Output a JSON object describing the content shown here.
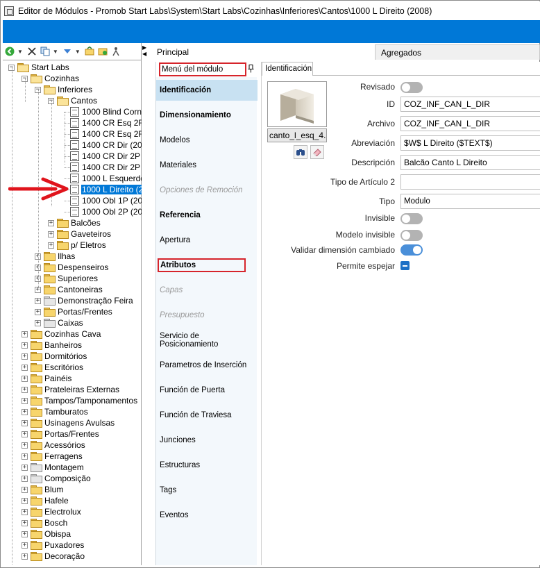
{
  "window": {
    "title": "Editor de Módulos - Promob Start Labs\\System\\Start Labs\\Cozinhas\\Inferiores\\Cantos\\1000 L Direito (2008)"
  },
  "toolbar": {
    "icons": [
      "back-icon",
      "delete-icon",
      "copy-icon",
      "move-down-icon",
      "refresh-icon",
      "folder-add-icon",
      "person-icon"
    ]
  },
  "tree": {
    "nodes": [
      {
        "label": "Start Labs",
        "expander": "−",
        "type": "folder-open"
      },
      {
        "label": "Cozinhas",
        "expander": "−",
        "type": "folder-open"
      },
      {
        "label": "Inferiores",
        "expander": "−",
        "type": "folder-open"
      },
      {
        "label": "Cantos",
        "expander": "−",
        "type": "folder-open"
      },
      {
        "label": "1000 Blind Corn",
        "type": "doc"
      },
      {
        "label": "1400 CR Esq 2F",
        "type": "doc"
      },
      {
        "label": "1400 CR Esq 2F",
        "type": "doc"
      },
      {
        "label": "1400 CR Dir (20",
        "type": "doc"
      },
      {
        "label": "1400 CR Dir 2P",
        "type": "doc"
      },
      {
        "label": "1400 CR Dir 2P",
        "type": "doc"
      },
      {
        "label": "1000 L Esquerdo",
        "type": "doc"
      },
      {
        "label": "1000 L Direito (2",
        "type": "doc",
        "selected": true
      },
      {
        "label": "1000 Obl 1P (20",
        "type": "doc"
      },
      {
        "label": "1000 Obl 2P (20",
        "type": "doc"
      },
      {
        "label": "Balcões",
        "expander": "+",
        "type": "folder"
      },
      {
        "label": "Gaveteiros",
        "expander": "+",
        "type": "folder"
      },
      {
        "label": "p/ Eletros",
        "expander": "+",
        "type": "folder"
      },
      {
        "label": "Ilhas",
        "expander": "+",
        "type": "folder"
      },
      {
        "label": "Despenseiros",
        "expander": "+",
        "type": "folder"
      },
      {
        "label": "Superiores",
        "expander": "+",
        "type": "folder"
      },
      {
        "label": "Cantoneiras",
        "expander": "+",
        "type": "folder"
      },
      {
        "label": "Demonstração Feira",
        "expander": "+",
        "type": "folder-gray"
      },
      {
        "label": "Portas/Frentes",
        "expander": "+",
        "type": "folder"
      },
      {
        "label": "Caixas",
        "expander": "+",
        "type": "folder-gray"
      },
      {
        "label": "Cozinhas Cava",
        "expander": "+",
        "type": "folder"
      },
      {
        "label": "Banheiros",
        "expander": "+",
        "type": "folder"
      },
      {
        "label": "Dormitórios",
        "expander": "+",
        "type": "folder"
      },
      {
        "label": "Escritórios",
        "expander": "+",
        "type": "folder"
      },
      {
        "label": "Painéis",
        "expander": "+",
        "type": "folder"
      },
      {
        "label": "Prateleiras Externas",
        "expander": "+",
        "type": "folder"
      },
      {
        "label": "Tampos/Tamponamentos",
        "expander": "+",
        "type": "folder"
      },
      {
        "label": "Tamburatos",
        "expander": "+",
        "type": "folder"
      },
      {
        "label": "Usinagens Avulsas",
        "expander": "+",
        "type": "folder"
      },
      {
        "label": "Portas/Frentes",
        "expander": "+",
        "type": "folder"
      },
      {
        "label": "Acessórios",
        "expander": "+",
        "type": "folder"
      },
      {
        "label": "Ferragens",
        "expander": "+",
        "type": "folder"
      },
      {
        "label": "Montagem",
        "expander": "+",
        "type": "folder-gray"
      },
      {
        "label": "Composição",
        "expander": "+",
        "type": "folder-gray"
      },
      {
        "label": "Blum",
        "expander": "+",
        "type": "folder"
      },
      {
        "label": "Hafele",
        "expander": "+",
        "type": "folder"
      },
      {
        "label": "Electrolux",
        "expander": "+",
        "type": "folder"
      },
      {
        "label": "Bosch",
        "expander": "+",
        "type": "folder"
      },
      {
        "label": "Obispa",
        "expander": "+",
        "type": "folder"
      },
      {
        "label": "Puxadores",
        "expander": "+",
        "type": "folder"
      },
      {
        "label": "Decoração",
        "expander": "+",
        "type": "folder"
      }
    ]
  },
  "tabs": {
    "principal": "Principal",
    "agregados": "Agregados"
  },
  "module_menu": {
    "header": "Menú del módulo",
    "items": [
      {
        "label": "Identificación",
        "state": "active"
      },
      {
        "label": "Dimensionamiento",
        "state": "bold"
      },
      {
        "label": "Modelos",
        "state": "normal"
      },
      {
        "label": "Materiales",
        "state": "normal"
      },
      {
        "label": "Opciones de Remoción",
        "state": "disabled"
      },
      {
        "label": "Referencia",
        "state": "bold"
      },
      {
        "label": "Apertura",
        "state": "normal"
      },
      {
        "label": "Atributos",
        "state": "bold-outlined"
      },
      {
        "label": "Capas",
        "state": "disabled"
      },
      {
        "label": "Presupuesto",
        "state": "disabled"
      },
      {
        "label": "Servicio de Posicionamiento",
        "state": "normal"
      },
      {
        "label": "Parametros de Inserción",
        "state": "normal"
      },
      {
        "label": "Función de Puerta",
        "state": "normal"
      },
      {
        "label": "Función de Traviesa",
        "state": "normal"
      },
      {
        "label": "Junciones",
        "state": "normal"
      },
      {
        "label": "Estructuras",
        "state": "normal"
      },
      {
        "label": "Tags",
        "state": "normal"
      },
      {
        "label": "Eventos",
        "state": "normal"
      }
    ]
  },
  "identification": {
    "tab": "Identificación",
    "thumbnail_caption": "canto_l_esq_4.",
    "fields": {
      "revisado_label": "Revisado",
      "revisado": false,
      "id_label": "ID",
      "id_value": "COZ_INF_CAN_L_DIR",
      "archivo_label": "Archivo",
      "archivo_value": "COZ_INF_CAN_L_DIR",
      "abreviacion_label": "Abreviación",
      "abreviacion_value": "$W$ L Direito ($TEXT$)",
      "descripcion_label": "Descripción",
      "descripcion_value": "Balcão Canto L Direito",
      "tipo_articulo_label": "Tipo de Artículo 2",
      "tipo_articulo_value": "",
      "tipo_label": "Tipo",
      "tipo_value": "Modulo",
      "invisible_label": "Invisible",
      "invisible": false,
      "modelo_invisible_label": "Modelo invisible",
      "modelo_invisible": false,
      "validar_label": "Validar dimensión cambiado",
      "validar": true,
      "permite_espejar_label": "Permite espejar",
      "permite_espejar": true
    }
  },
  "colors": {
    "ribbon": "#0078d7",
    "selection": "#0078d7",
    "highlight_outline": "#d6242b",
    "menu_background": "#f3f8fc",
    "menu_active": "#c8e1f2",
    "annotation_arrow": "#e0141c"
  }
}
